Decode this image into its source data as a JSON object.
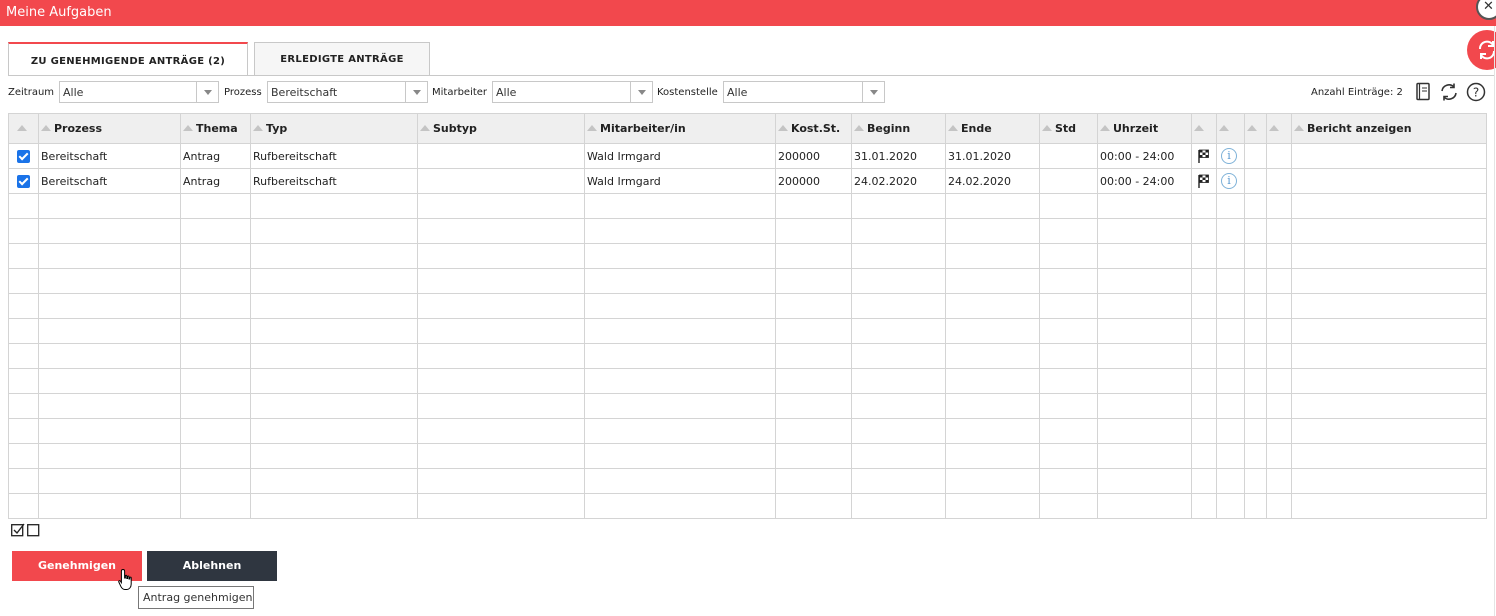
{
  "window": {
    "title": "Meine Aufgaben"
  },
  "tabs": [
    {
      "label": "ZU GENEHMIGENDE ANTRÄGE (2)",
      "active": true
    },
    {
      "label": "ERLEDIGTE ANTRÄGE",
      "active": false
    }
  ],
  "filters": {
    "zeitraum": {
      "label": "Zeitraum",
      "value": "Alle"
    },
    "prozess": {
      "label": "Prozess",
      "value": "Bereitschaft"
    },
    "mitarbeiter": {
      "label": "Mitarbeiter",
      "value": "Alle"
    },
    "kostenstelle": {
      "label": "Kostenstelle",
      "value": "Alle"
    }
  },
  "toolbar": {
    "count_label": "Anzahl Einträge: 2",
    "icons": [
      "report-icon",
      "refresh-icon",
      "help-icon"
    ]
  },
  "table": {
    "columns": [
      "",
      "Prozess",
      "Thema",
      "Typ",
      "Subtyp",
      "Mitarbeiter/in",
      "Kost.St.",
      "Beginn",
      "Ende",
      "Std",
      "Uhrzeit",
      "",
      "",
      "",
      "",
      "Bericht anzeigen"
    ],
    "rows": [
      {
        "checked": true,
        "prozess": "Bereitschaft",
        "thema": "Antrag",
        "typ": "Rufbereitschaft",
        "subtyp": "",
        "mitarbeiter": "Wald Irmgard",
        "kostst": "200000",
        "beginn": "31.01.2020",
        "ende": "31.01.2020",
        "std": "",
        "uhrzeit": "00:00 - 24:00"
      },
      {
        "checked": true,
        "prozess": "Bereitschaft",
        "thema": "Antrag",
        "typ": "Rufbereitschaft",
        "subtyp": "",
        "mitarbeiter": "Wald Irmgard",
        "kostst": "200000",
        "beginn": "24.02.2020",
        "ende": "24.02.2020",
        "std": "",
        "uhrzeit": "00:00 - 24:00"
      }
    ],
    "empty_rows": 13
  },
  "actions": {
    "approve": "Genehmigen",
    "reject": "Ablehnen",
    "tooltip": "Antrag genehmigen"
  },
  "colors": {
    "accent": "#f2484d",
    "dark": "#2f3640",
    "checkbox": "#1a73e8"
  }
}
